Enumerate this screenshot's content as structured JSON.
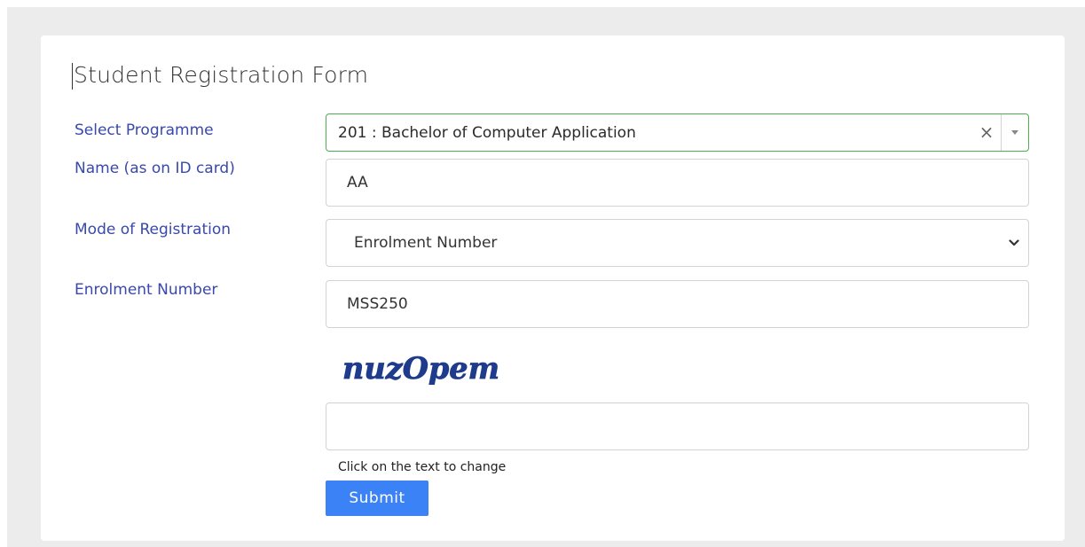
{
  "form": {
    "title": "Student Registration Form",
    "programme": {
      "label": "Select Programme",
      "selected": "201 : Bachelor of Computer Application",
      "clear_glyph": "×"
    },
    "name": {
      "label": "Name (as on ID card)",
      "value": "AA"
    },
    "mode": {
      "label": "Mode of Registration",
      "selected": "Enrolment Number"
    },
    "enrolment": {
      "label": "Enrolment Number",
      "value": "MSS250"
    },
    "captcha": {
      "text": "nuzOpem",
      "value": "",
      "hint": "Click on the text to change"
    },
    "submit_label": "Submit"
  },
  "colors": {
    "label": "#3949ab",
    "focus_border": "#4cae4c",
    "submit_bg": "#3b82f6",
    "captcha_ink": "#1f3b8c",
    "page_bg": "#ececec"
  },
  "icons": {
    "programme_arrow": "caret-down-icon",
    "mode_arrow": "chevron-down-icon",
    "clear": "close-icon"
  }
}
